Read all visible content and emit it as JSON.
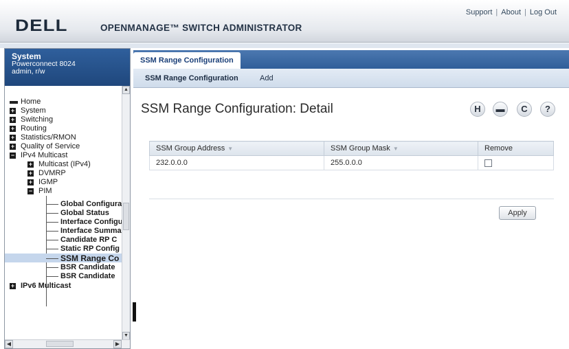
{
  "header": {
    "logo": "DELL",
    "product": "OPENMANAGE™ SWITCH ADMINISTRATOR",
    "links": [
      "Support",
      "About",
      "Log Out"
    ]
  },
  "sidebar": {
    "system_title": "System",
    "device": "Powerconnect 8024",
    "user": "admin, r/w",
    "tree": {
      "home": "Home",
      "system": "System",
      "switching": "Switching",
      "routing": "Routing",
      "statistics": "Statistics/RMON",
      "qos": "Quality of Service",
      "ipv4_multicast": "IPv4 Multicast",
      "multicast_ipv4": "Multicast (IPv4)",
      "dvmrp": "DVMRP",
      "igmp": "IGMP",
      "pim": "PIM",
      "pim_children": [
        "Global Configura",
        "Global Status",
        "Interface Configu",
        "Interface Summa",
        "Candidate RP C",
        "Static RP Config",
        "SSM Range Co",
        "BSR Candidate",
        "BSR Candidate"
      ],
      "ipv6_multicast": "IPv6 Multicast"
    }
  },
  "tabs": {
    "main": "SSM Range Configuration",
    "sub": [
      "SSM Range Configuration",
      "Add"
    ]
  },
  "page": {
    "title": "SSM Range Configuration: Detail",
    "tools": [
      "save-icon",
      "print-icon",
      "refresh-icon",
      "help-icon"
    ],
    "table": {
      "headers": [
        "SSM Group Address",
        "SSM Group Mask",
        "Remove"
      ],
      "rows": [
        {
          "address": "232.0.0.0",
          "mask": "255.0.0.0",
          "remove": false
        }
      ]
    },
    "apply_label": "Apply"
  },
  "colors": {
    "accent_blue": "#2f5e99",
    "header_bg": "#e6e9ee",
    "selected_row": "#c5d6ec"
  }
}
